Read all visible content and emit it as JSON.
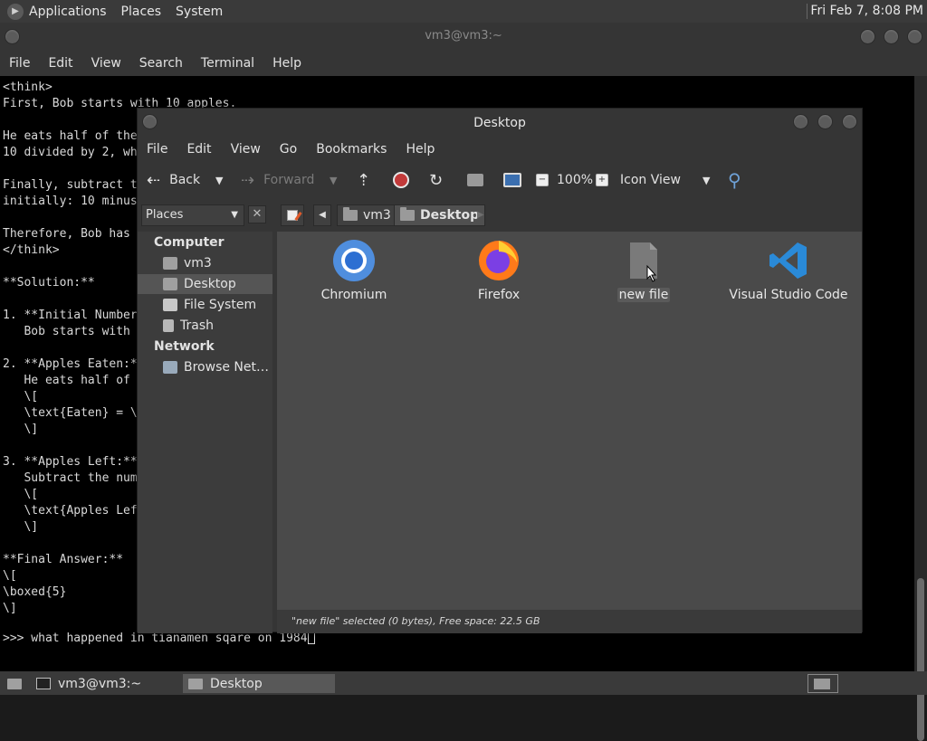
{
  "top_panel": {
    "menus": [
      "Applications",
      "Places",
      "System"
    ],
    "clock": "Fri Feb  7,  8:08 PM"
  },
  "terminal": {
    "title": "vm3@vm3:~",
    "menus": [
      "File",
      "Edit",
      "View",
      "Search",
      "Terminal",
      "Help"
    ],
    "lines": [
      "<think>",
      "First, Bob starts with 10 apples.",
      "",
      "He eats half of the",
      "10 divided by 2, wh",
      "",
      "Finally, subtract t",
      "initially: 10 minus",
      "",
      "Therefore, Bob has ",
      "</think>",
      "",
      "**Solution:**",
      "",
      "1. **Initial Number",
      "   Bob starts with ",
      "",
      "2. **Apples Eaten:*",
      "   He eats half of ",
      "   \\[",
      "   \\text{Eaten} = \\",
      "   \\]",
      "",
      "3. **Apples Left:**",
      "   Subtract the num",
      "   \\[",
      "   \\text{Apples Lef",
      "   \\]",
      "",
      "**Final Answer:**",
      "\\[",
      "\\boxed{5}",
      "\\]"
    ],
    "prompt": ">>> what happened in tianamen sqare on 1984"
  },
  "file_manager": {
    "title": "Desktop",
    "menus": [
      "File",
      "Edit",
      "View",
      "Go",
      "Bookmarks",
      "Help"
    ],
    "toolbar": {
      "back": "Back",
      "forward": "Forward",
      "zoom": "100%",
      "view_mode": "Icon View"
    },
    "sidebar_selector": "Places",
    "breadcrumbs": [
      "vm3",
      "Desktop"
    ],
    "sidebar": {
      "computer_heading": "Computer",
      "computer_items": [
        "vm3",
        "Desktop",
        "File System",
        "Trash"
      ],
      "network_heading": "Network",
      "network_items": [
        "Browse Net…"
      ]
    },
    "desktop_items": [
      "Chromium",
      "Firefox",
      "new file",
      "Visual Studio Code"
    ],
    "status": "\"new file\" selected (0 bytes), Free space: 22.5 GB",
    "colors": {
      "vscode": "#2a8ad8",
      "chromium": "#3b82d8",
      "firefox": "#ff7a1a"
    }
  },
  "bottom_panel": {
    "tasks": [
      "vm3@vm3:~",
      "Desktop"
    ]
  }
}
